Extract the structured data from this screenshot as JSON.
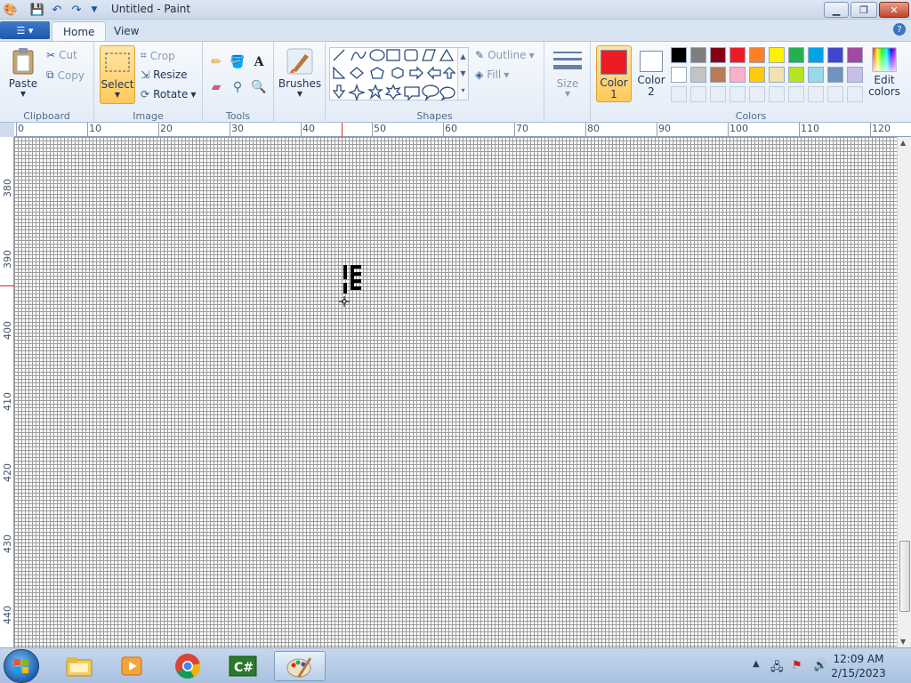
{
  "window": {
    "title": "Untitled - Paint"
  },
  "tabs": [
    {
      "label": "Home"
    },
    {
      "label": "View"
    }
  ],
  "clipboard": {
    "paste": "Paste",
    "cut": "Cut",
    "copy": "Copy",
    "label": "Clipboard"
  },
  "image": {
    "select": "Select",
    "crop": "Crop",
    "resize": "Resize",
    "rotate": "Rotate",
    "label": "Image"
  },
  "tools": {
    "label": "Tools"
  },
  "brushes": {
    "label": "Brushes"
  },
  "shapes": {
    "outline": "Outline",
    "fill": "Fill",
    "label": "Shapes"
  },
  "size": {
    "label": "Size"
  },
  "colors": {
    "color1": {
      "line1": "Color",
      "line2": "1",
      "value": "#ed1c24"
    },
    "color2": {
      "line1": "Color",
      "line2": "2",
      "value": "#ffffff"
    },
    "edit": {
      "line1": "Edit",
      "line2": "colors"
    },
    "label": "Colors",
    "palette_row1": [
      "#000000",
      "#7f7f7f",
      "#880015",
      "#ed1c24",
      "#ff7f27",
      "#fff200",
      "#22b14c",
      "#00a2e8",
      "#3f48cc",
      "#a349a4"
    ],
    "palette_row2": [
      "#ffffff",
      "#c3c3c3",
      "#b97a57",
      "#ffaec9",
      "#ffc90e",
      "#efe4b0",
      "#b5e61d",
      "#99d9ea",
      "#7092be",
      "#c8bfe7"
    ]
  },
  "ruler": {
    "h": [
      "0",
      "10",
      "20",
      "30",
      "40",
      "50",
      "60",
      "70",
      "80",
      "90",
      "100",
      "110",
      "120"
    ],
    "v": [
      "380",
      "390",
      "400",
      "410",
      "420",
      "430",
      "440"
    ]
  },
  "taskbar": {
    "time": "12:09 AM",
    "date": "2/15/2023"
  }
}
